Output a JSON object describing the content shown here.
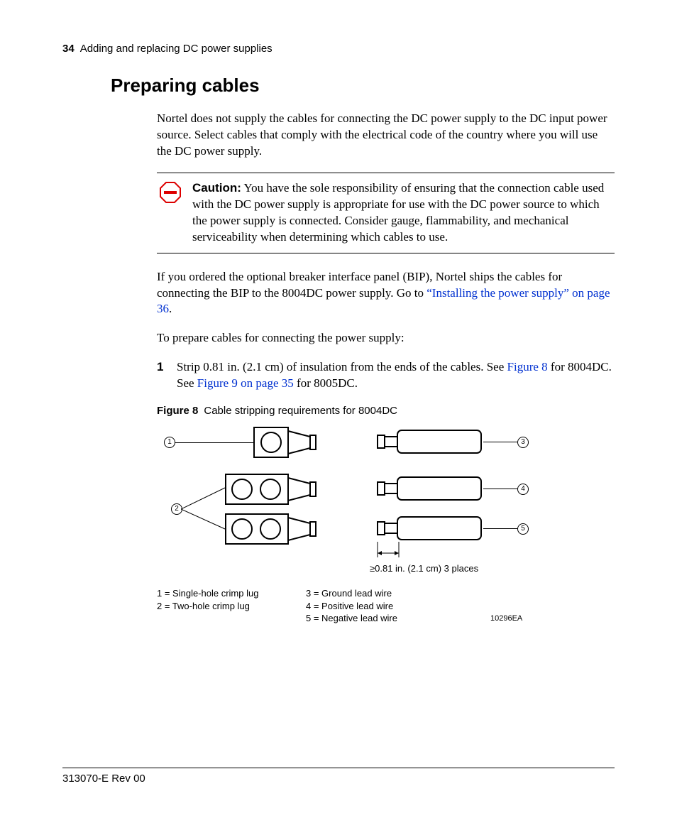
{
  "header": {
    "pagenum": "34",
    "chapter": "Adding and replacing DC power supplies"
  },
  "section_title": "Preparing cables",
  "intro": "Nortel does not supply the cables for connecting the DC power supply to the DC input power source. Select cables that comply with the electrical code of the country where you will use the DC power supply.",
  "caution": {
    "label": "Caution:",
    "text": " You have the sole responsibility of ensuring that the connection cable used with the DC power supply is appropriate for use with the DC power source to which the power supply is connected. Consider gauge, flammability, and mechanical serviceability when determining which cables to use."
  },
  "para2_a": "If you ordered the optional breaker interface panel (BIP), Nortel ships the cables for connecting the BIP to the 8004DC power supply. Go to ",
  "para2_link": "“Installing the power supply” on page 36",
  "para2_b": ".",
  "para3": "To prepare cables for connecting the power supply:",
  "step1": {
    "num": "1",
    "a": "Strip 0.81 in. (2.1 cm) of insulation from the ends of the cables. See ",
    "link1": "Figure 8",
    "b": " for 8004DC. See ",
    "link2": "Figure 9 on page 35",
    "c": " for 8005DC."
  },
  "figure": {
    "label": "Figure 8",
    "title": "Cable stripping requirements for 8004DC",
    "callouts": {
      "c1": "1",
      "c2": "2",
      "c3": "3",
      "c4": "4",
      "c5": "5"
    },
    "dim": "≥0.81 in. (2.1 cm) 3 places",
    "legend": {
      "l1": "1 = Single-hole crimp lug",
      "l2": "2 = Two-hole crimp lug",
      "l3": "3 = Ground lead wire",
      "l4": "4 = Positive lead wire",
      "l5": "5 = Negative lead wire"
    },
    "code": "10296EA"
  },
  "footer": "313070-E Rev 00"
}
